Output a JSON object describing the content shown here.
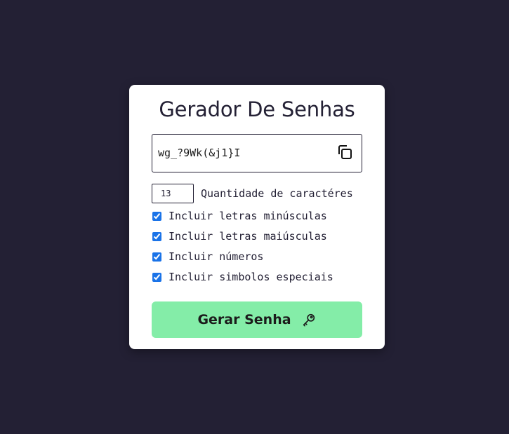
{
  "card": {
    "title": "Gerador De Senhas"
  },
  "password": {
    "value": "wg_?9Wk(&j1}I",
    "copy_icon": "copy-icon"
  },
  "length": {
    "value": "13",
    "label": "Quantidade de caractéres"
  },
  "options": {
    "lowercase": {
      "label": "Incluir letras minúsculas",
      "checked": true
    },
    "uppercase": {
      "label": "Incluir letras maiúsculas",
      "checked": true
    },
    "numbers": {
      "label": "Incluir números",
      "checked": true
    },
    "symbols": {
      "label": "Incluir simbolos especiais",
      "checked": true
    }
  },
  "generate": {
    "label": "Gerar Senha",
    "icon": "key-icon"
  },
  "colors": {
    "background": "#232034",
    "card": "#ffffff",
    "button": "#84eda8",
    "checkbox": "#1a73e8"
  }
}
